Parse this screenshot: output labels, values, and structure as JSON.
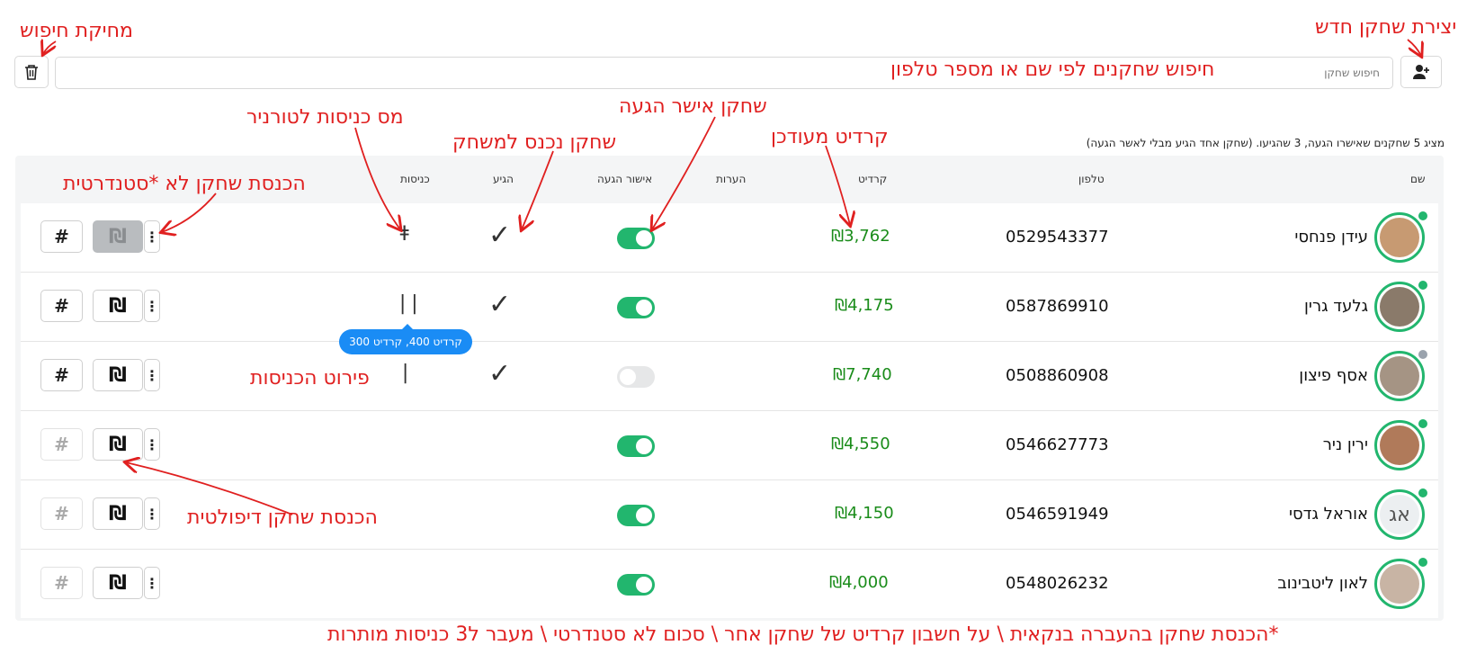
{
  "search": {
    "placeholder": "חיפוש שחקן"
  },
  "summary_text": "מציג 5 שחקנים שאישרו הגעה, 3 שהגיעו. (שחקן אחד הגיע מבלי לאשר הגעה)",
  "columns": {
    "name": "שם",
    "phone": "טלפון",
    "credit": "קרדיט",
    "notes": "הערות",
    "approval": "אישור הגעה",
    "arrived": "הגיע",
    "entries": "כניסות"
  },
  "players": [
    {
      "name": "עידן פנחסי",
      "phone": "0529543377",
      "credit": "₪3,762",
      "approved": true,
      "arrived": true,
      "entries": 2,
      "status_color": "#22b66e",
      "default_entry_button": "disabled"
    },
    {
      "name": "גלעד גרין",
      "phone": "0587869910",
      "credit": "₪4,175",
      "approved": true,
      "arrived": true,
      "entries": 2,
      "status_color": "#22b66e"
    },
    {
      "name": "אסף פיצון",
      "phone": "0508860908",
      "credit": "₪7,740",
      "approved": false,
      "arrived": true,
      "entries": 1,
      "status_color": "#9aa3ad"
    },
    {
      "name": "ירין ניר",
      "phone": "0546627773",
      "credit": "₪4,550",
      "approved": true,
      "arrived": false,
      "entries": 0,
      "status_color": "#22b66e"
    },
    {
      "name": "אוראל גדסי",
      "phone": "0546591949",
      "credit": "₪4,150",
      "approved": true,
      "arrived": false,
      "entries": 0,
      "status_color": "#22b66e",
      "initials": "אג"
    },
    {
      "name": "לאון ליטבינוב",
      "phone": "0548026232",
      "credit": "₪4,000",
      "approved": true,
      "arrived": false,
      "entries": 0,
      "status_color": "#22b66e"
    }
  ],
  "buttons": {
    "hash_label": "#",
    "shekel_label": "₪",
    "menu_label": "⋮"
  },
  "tooltip": "קרדיט 400, קרדיט 300",
  "annotations": {
    "clear_search": "מחיקת חיפוש",
    "create_player": "יצירת שחקן חדש",
    "search_hint": "חיפוש שחקנים לפי שם או מספר טלפון",
    "entries_count": "מס כניסות לטורניר",
    "player_entered": "שחקן נכנס למשחק",
    "player_approved": "שחקן אישר הגעה",
    "updated_credit": "קרדיט מעודכן",
    "nonstandard_entry": "הכנסת שחקן לא *סטנדרטית",
    "entries_breakdown": "פירוט הכניסות",
    "default_entry": "הכנסת שחקן דיפולטית",
    "footnote": "*הכנסת שחקן בהעברה בנקאית \\ על חשבון קרדיט של שחקן אחר \\ סכום לא סטנדרטי \\ מעבר ל3 כניסות מותרות"
  },
  "colors": {
    "accent_green": "#22b66e",
    "credit_green": "#1a8c1a",
    "annotation_red": "#e02020",
    "tooltip_blue": "#1a8cf5"
  }
}
